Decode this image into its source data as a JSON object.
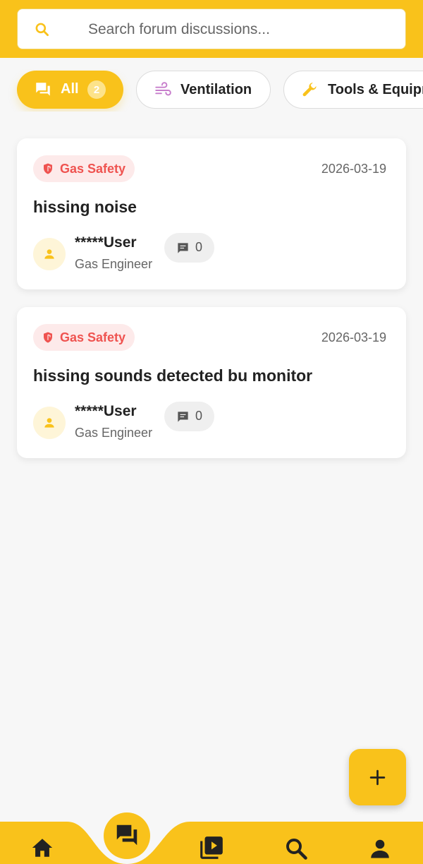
{
  "search": {
    "placeholder": "Search forum discussions..."
  },
  "chips": [
    {
      "label": "All",
      "count": "2",
      "icon": "forum-icon",
      "active": true
    },
    {
      "label": "Ventilation",
      "icon": "air-icon",
      "active": false
    },
    {
      "label": "Tools & Equipment",
      "icon": "wrench-icon",
      "active": false
    }
  ],
  "posts": [
    {
      "category": "Gas Safety",
      "date": "2026-03-19",
      "title": "hissing noise",
      "user": "*****User",
      "role": "Gas Engineer",
      "comments": "0"
    },
    {
      "category": "Gas Safety",
      "date": "2026-03-19",
      "title": "hissing sounds detected bu monitor",
      "user": "*****User",
      "role": "Gas Engineer",
      "comments": "0"
    }
  ],
  "colors": {
    "accent": "#f9c21b",
    "category_red": "#ef5350"
  },
  "nav": [
    {
      "icon": "home-icon"
    },
    {
      "icon": "forum-icon",
      "active": true
    },
    {
      "icon": "video-library-icon"
    },
    {
      "icon": "search-icon"
    },
    {
      "icon": "person-icon"
    }
  ],
  "fab": {
    "icon": "plus-icon"
  }
}
